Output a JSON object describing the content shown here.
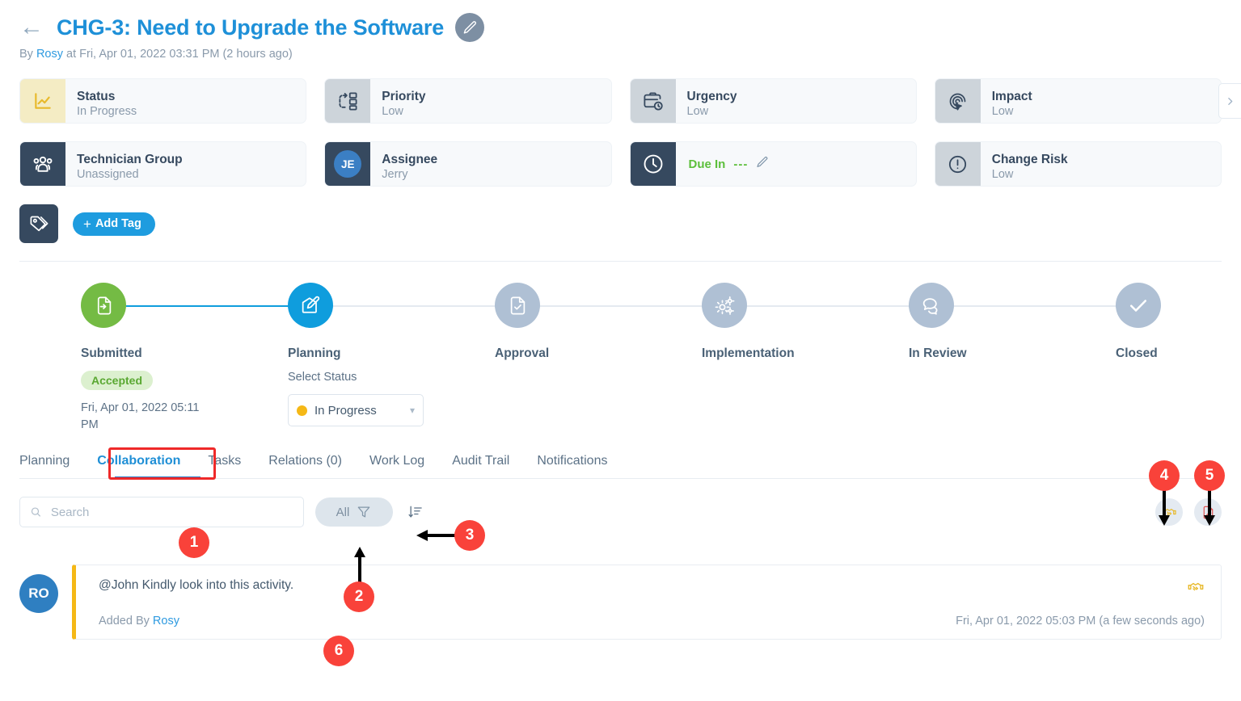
{
  "header": {
    "back_icon": "arrow-left-icon",
    "title": "CHG-3: Need to Upgrade the Software",
    "edit_icon": "pencil-icon",
    "meta_prefix": "By",
    "meta_author": "Rosy",
    "meta_suffix": "at Fri, Apr 01, 2022 03:31 PM (2 hours ago)"
  },
  "cards": [
    {
      "label": "Status",
      "value": "In Progress",
      "icon": "chart-line-icon",
      "icon_style": "yellow"
    },
    {
      "label": "Priority",
      "value": "Low",
      "icon": "priority-flow-icon",
      "icon_style": "grey"
    },
    {
      "label": "Urgency",
      "value": "Low",
      "icon": "briefcase-clock-icon",
      "icon_style": "grey"
    },
    {
      "label": "Impact",
      "value": "Low",
      "icon": "fingerprint-arrow-icon",
      "icon_style": "grey"
    },
    {
      "label": "Technician Group",
      "value": "Unassigned",
      "icon": "people-group-icon",
      "icon_style": "dark"
    },
    {
      "label": "Assignee",
      "value": "Jerry",
      "icon": "avatar-initials",
      "icon_style": "dark",
      "initials": "JE"
    },
    {
      "label": "Due In",
      "value": "---",
      "icon": "clock-icon",
      "icon_style": "dark",
      "is_due": true,
      "edit_icon": "pencil-icon"
    },
    {
      "label": "Change Risk",
      "value": "Low",
      "icon": "exclamation-circle-icon",
      "icon_style": "grey"
    }
  ],
  "cards_next_icon": "chevron-right-icon",
  "tag_row": {
    "tag_icon": "tags-icon",
    "add_tag_label": "Add Tag",
    "add_tag_plus": "+"
  },
  "stepper": [
    {
      "name": "Submitted",
      "icon": "document-in-icon",
      "state": "done",
      "badge": "Accepted",
      "date": "Fri, Apr 01, 2022 05:11 PM"
    },
    {
      "name": "Planning",
      "icon": "planning-pencil-icon",
      "state": "current",
      "select_label": "Select Status",
      "select_value": "In Progress"
    },
    {
      "name": "Approval",
      "icon": "document-check-icon",
      "state": "idle"
    },
    {
      "name": "Implementation",
      "icon": "gears-icon",
      "state": "idle"
    },
    {
      "name": "In Review",
      "icon": "chat-bubbles-icon",
      "state": "idle"
    },
    {
      "name": "Closed",
      "icon": "check-icon",
      "state": "idle"
    }
  ],
  "tabs": [
    {
      "label": "Planning",
      "active": false
    },
    {
      "label": "Collaboration",
      "active": true
    },
    {
      "label": "Tasks",
      "active": false
    },
    {
      "label": "Relations (0)",
      "active": false
    },
    {
      "label": "Work Log",
      "active": false
    },
    {
      "label": "Audit Trail",
      "active": false
    },
    {
      "label": "Notifications",
      "active": false
    }
  ],
  "toolbar": {
    "search_placeholder": "Search",
    "search_value": "",
    "search_icon": "search-icon",
    "filter_label": "All",
    "filter_icon": "funnel-icon",
    "sort_icon": "sort-descending-icon",
    "handshake_icon": "handshake-icon",
    "note_edit_icon": "document-pencil-icon"
  },
  "comment": {
    "avatar_initials": "RO",
    "text": "@John Kindly look into this activity.",
    "added_by_label": "Added By",
    "added_by_name": "Rosy",
    "timestamp": "Fri, Apr 01, 2022 05:03 PM (a few seconds ago)",
    "type_icon": "handshake-icon"
  },
  "annotations": [
    {
      "number": "1"
    },
    {
      "number": "2"
    },
    {
      "number": "3"
    },
    {
      "number": "4"
    },
    {
      "number": "5"
    },
    {
      "number": "6"
    }
  ],
  "colors": {
    "accent_blue": "#1e90d8",
    "annotation_red": "#f9423a",
    "green": "#74bb44",
    "amber": "#f5b816",
    "dark_navy": "#36495f"
  }
}
